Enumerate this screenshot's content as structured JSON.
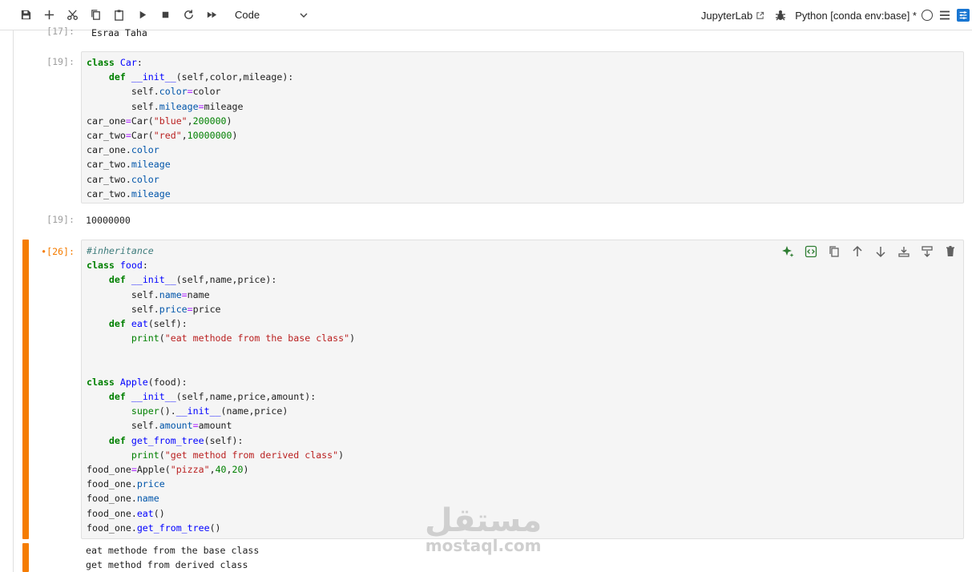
{
  "toolbar": {
    "cell_type": "Code",
    "jupyterlab_label": "JupyterLab",
    "kernel_name": "Python [conda env:base] *"
  },
  "cells": {
    "top_output": {
      "prompt": "[17]:",
      "text": "Esraa Taha"
    },
    "car_cell": {
      "prompt": "[19]:",
      "output_prompt": "[19]:",
      "output": "10000000"
    },
    "food_cell": {
      "prompt": "•[26]:",
      "output_lines": [
        "eat methode from the base class",
        "get method from derived class"
      ]
    }
  },
  "watermark": {
    "arabic": "مستقل",
    "latin": "mostaql.com"
  },
  "colors": {
    "accent": "#f57c00",
    "brand": "#1976d2",
    "toolbar_green": "#2e7d32"
  }
}
